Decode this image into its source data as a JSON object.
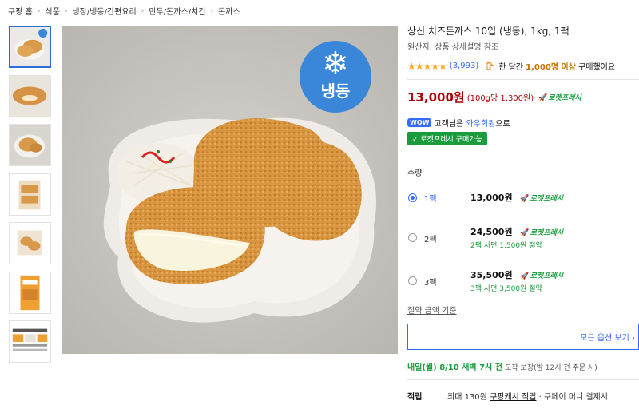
{
  "breadcrumb": [
    "쿠팡 홈",
    "식품",
    "냉장/냉동/간편요리",
    "만두/돈까스/치킨",
    "돈까스"
  ],
  "product": {
    "title": "상신 치즈돈까스 10입 (냉동), 1kg, 1팩",
    "origin": "원산지: 상품 상세설명 참조",
    "stars": "★★★★★",
    "review_count": "(3,993)",
    "buy_prefix": "한 달간",
    "buy_count": "1,000명 이상",
    "buy_suffix": "구매했어요",
    "price": "13,000원",
    "unit_price": "(100g당 1,300원)",
    "rocket_label": "로켓프레시",
    "wow_badge": "WOW",
    "wow_text_1": "고객님은",
    "wow_link": "와우회원",
    "wow_text_2": "으로",
    "rf_pill": "✓ 로켓프레시 구매가능",
    "frozen_label": "냉동",
    "frozen_icon": "snowflake-icon"
  },
  "quantity": {
    "label": "수량",
    "options": [
      {
        "pack": "1팩",
        "price": "13,000원",
        "rocket": "로켓프레시",
        "save": "",
        "selected": true
      },
      {
        "pack": "2팩",
        "price": "24,500원",
        "rocket": "로켓프레시",
        "save": "2팩 사면 1,500원 절약",
        "selected": false
      },
      {
        "pack": "3팩",
        "price": "35,500원",
        "rocket": "로켓프레시",
        "save": "3팩 사면 3,500원 절약",
        "selected": false
      }
    ],
    "criteria_link": "절약 금액 기준",
    "all_options_button": "모든 옵션 보기 ›"
  },
  "delivery": {
    "date": "내일(월) 8/10 새벽 7시 전",
    "guarantee": "도착 보장",
    "note": "(밤 12시 전 주문 시)"
  },
  "points": {
    "label": "적립",
    "text_1": "최대 130원",
    "link": "쿠팡캐시 적립",
    "text_2": "· 쿠페이 머니 결제시"
  },
  "colors": {
    "price_red": "#ae0000",
    "rocket_green": "#1a9c3c",
    "link_blue": "#346aff",
    "frozen_badge_blue": "#3a86d9",
    "star_orange": "#f5a623"
  }
}
